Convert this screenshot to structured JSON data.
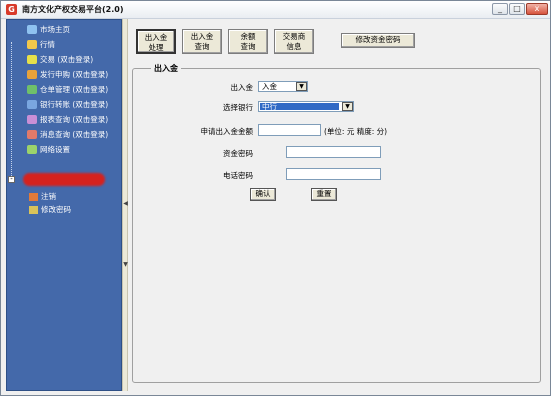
{
  "window": {
    "title": "南方文化产权交易平台(2.0)",
    "close_glyph": "x"
  },
  "sidebar": {
    "items": [
      {
        "label": "市场主页",
        "icon": "globe-icon",
        "color": "#8fc2f0"
      },
      {
        "label": "行情",
        "icon": "chart-icon",
        "color": "#f2c84b"
      },
      {
        "label": "交易 (双击登录)",
        "icon": "trade-icon",
        "color": "#e6e04a"
      },
      {
        "label": "发行申购 (双击登录)",
        "icon": "subscribe-icon",
        "color": "#e8a23a"
      },
      {
        "label": "仓单管理 (双击登录)",
        "icon": "warehouse-icon",
        "color": "#6fc06a"
      },
      {
        "label": "银行转账 (双击登录)",
        "icon": "bank-icon",
        "color": "#7aa6e0"
      },
      {
        "label": "报表查询 (双击登录)",
        "icon": "report-icon",
        "color": "#c98fd6"
      },
      {
        "label": "消息查询 (双击登录)",
        "icon": "message-icon",
        "color": "#e07a6a"
      },
      {
        "label": "网络设置",
        "icon": "network-icon",
        "color": "#9bd36b"
      }
    ],
    "expander": "-",
    "sub_items": [
      {
        "label": "注销",
        "icon": "logout-icon"
      },
      {
        "label": "修改密码",
        "icon": "edit-password-icon"
      }
    ]
  },
  "toolbar": {
    "tabs": [
      {
        "line1": "出入金",
        "line2": "处理",
        "active": true
      },
      {
        "line1": "出入金",
        "line2": "查询",
        "active": false
      },
      {
        "line1": "余额",
        "line2": "查询",
        "active": false
      },
      {
        "line1": "交易商",
        "line2": "信息",
        "active": false
      }
    ],
    "change_password_label": "修改资金密码"
  },
  "form": {
    "legend": "出入金",
    "direction": {
      "label": "出入金",
      "value": "入金"
    },
    "bank": {
      "label": "选择银行",
      "value": "中行"
    },
    "amount": {
      "label": "申请出入金金额",
      "value": "",
      "hint": "(单位: 元  精度: 分)"
    },
    "fund_password": {
      "label": "资金密码",
      "value": ""
    },
    "phone_password": {
      "label": "电话密码",
      "value": ""
    },
    "confirm_label": "确认",
    "reset_label": "重置"
  },
  "splitter": {
    "left_arrow": "◀",
    "down_arrow": "▼"
  }
}
